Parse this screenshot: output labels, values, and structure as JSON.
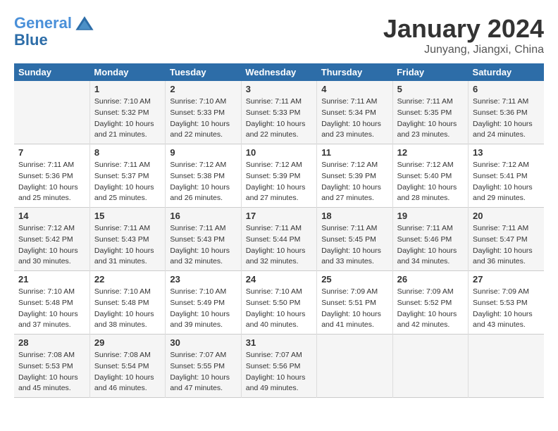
{
  "header": {
    "logo_line1": "General",
    "logo_line2": "Blue",
    "month": "January 2024",
    "location": "Junyang, Jiangxi, China"
  },
  "weekdays": [
    "Sunday",
    "Monday",
    "Tuesday",
    "Wednesday",
    "Thursday",
    "Friday",
    "Saturday"
  ],
  "weeks": [
    [
      {
        "day": "",
        "info": ""
      },
      {
        "day": "1",
        "info": "Sunrise: 7:10 AM\nSunset: 5:32 PM\nDaylight: 10 hours\nand 21 minutes."
      },
      {
        "day": "2",
        "info": "Sunrise: 7:10 AM\nSunset: 5:33 PM\nDaylight: 10 hours\nand 22 minutes."
      },
      {
        "day": "3",
        "info": "Sunrise: 7:11 AM\nSunset: 5:33 PM\nDaylight: 10 hours\nand 22 minutes."
      },
      {
        "day": "4",
        "info": "Sunrise: 7:11 AM\nSunset: 5:34 PM\nDaylight: 10 hours\nand 23 minutes."
      },
      {
        "day": "5",
        "info": "Sunrise: 7:11 AM\nSunset: 5:35 PM\nDaylight: 10 hours\nand 23 minutes."
      },
      {
        "day": "6",
        "info": "Sunrise: 7:11 AM\nSunset: 5:36 PM\nDaylight: 10 hours\nand 24 minutes."
      }
    ],
    [
      {
        "day": "7",
        "info": "Sunrise: 7:11 AM\nSunset: 5:36 PM\nDaylight: 10 hours\nand 25 minutes."
      },
      {
        "day": "8",
        "info": "Sunrise: 7:11 AM\nSunset: 5:37 PM\nDaylight: 10 hours\nand 25 minutes."
      },
      {
        "day": "9",
        "info": "Sunrise: 7:12 AM\nSunset: 5:38 PM\nDaylight: 10 hours\nand 26 minutes."
      },
      {
        "day": "10",
        "info": "Sunrise: 7:12 AM\nSunset: 5:39 PM\nDaylight: 10 hours\nand 27 minutes."
      },
      {
        "day": "11",
        "info": "Sunrise: 7:12 AM\nSunset: 5:39 PM\nDaylight: 10 hours\nand 27 minutes."
      },
      {
        "day": "12",
        "info": "Sunrise: 7:12 AM\nSunset: 5:40 PM\nDaylight: 10 hours\nand 28 minutes."
      },
      {
        "day": "13",
        "info": "Sunrise: 7:12 AM\nSunset: 5:41 PM\nDaylight: 10 hours\nand 29 minutes."
      }
    ],
    [
      {
        "day": "14",
        "info": "Sunrise: 7:12 AM\nSunset: 5:42 PM\nDaylight: 10 hours\nand 30 minutes."
      },
      {
        "day": "15",
        "info": "Sunrise: 7:11 AM\nSunset: 5:43 PM\nDaylight: 10 hours\nand 31 minutes."
      },
      {
        "day": "16",
        "info": "Sunrise: 7:11 AM\nSunset: 5:43 PM\nDaylight: 10 hours\nand 32 minutes."
      },
      {
        "day": "17",
        "info": "Sunrise: 7:11 AM\nSunset: 5:44 PM\nDaylight: 10 hours\nand 32 minutes."
      },
      {
        "day": "18",
        "info": "Sunrise: 7:11 AM\nSunset: 5:45 PM\nDaylight: 10 hours\nand 33 minutes."
      },
      {
        "day": "19",
        "info": "Sunrise: 7:11 AM\nSunset: 5:46 PM\nDaylight: 10 hours\nand 34 minutes."
      },
      {
        "day": "20",
        "info": "Sunrise: 7:11 AM\nSunset: 5:47 PM\nDaylight: 10 hours\nand 36 minutes."
      }
    ],
    [
      {
        "day": "21",
        "info": "Sunrise: 7:10 AM\nSunset: 5:48 PM\nDaylight: 10 hours\nand 37 minutes."
      },
      {
        "day": "22",
        "info": "Sunrise: 7:10 AM\nSunset: 5:48 PM\nDaylight: 10 hours\nand 38 minutes."
      },
      {
        "day": "23",
        "info": "Sunrise: 7:10 AM\nSunset: 5:49 PM\nDaylight: 10 hours\nand 39 minutes."
      },
      {
        "day": "24",
        "info": "Sunrise: 7:10 AM\nSunset: 5:50 PM\nDaylight: 10 hours\nand 40 minutes."
      },
      {
        "day": "25",
        "info": "Sunrise: 7:09 AM\nSunset: 5:51 PM\nDaylight: 10 hours\nand 41 minutes."
      },
      {
        "day": "26",
        "info": "Sunrise: 7:09 AM\nSunset: 5:52 PM\nDaylight: 10 hours\nand 42 minutes."
      },
      {
        "day": "27",
        "info": "Sunrise: 7:09 AM\nSunset: 5:53 PM\nDaylight: 10 hours\nand 43 minutes."
      }
    ],
    [
      {
        "day": "28",
        "info": "Sunrise: 7:08 AM\nSunset: 5:53 PM\nDaylight: 10 hours\nand 45 minutes."
      },
      {
        "day": "29",
        "info": "Sunrise: 7:08 AM\nSunset: 5:54 PM\nDaylight: 10 hours\nand 46 minutes."
      },
      {
        "day": "30",
        "info": "Sunrise: 7:07 AM\nSunset: 5:55 PM\nDaylight: 10 hours\nand 47 minutes."
      },
      {
        "day": "31",
        "info": "Sunrise: 7:07 AM\nSunset: 5:56 PM\nDaylight: 10 hours\nand 49 minutes."
      },
      {
        "day": "",
        "info": ""
      },
      {
        "day": "",
        "info": ""
      },
      {
        "day": "",
        "info": ""
      }
    ]
  ]
}
